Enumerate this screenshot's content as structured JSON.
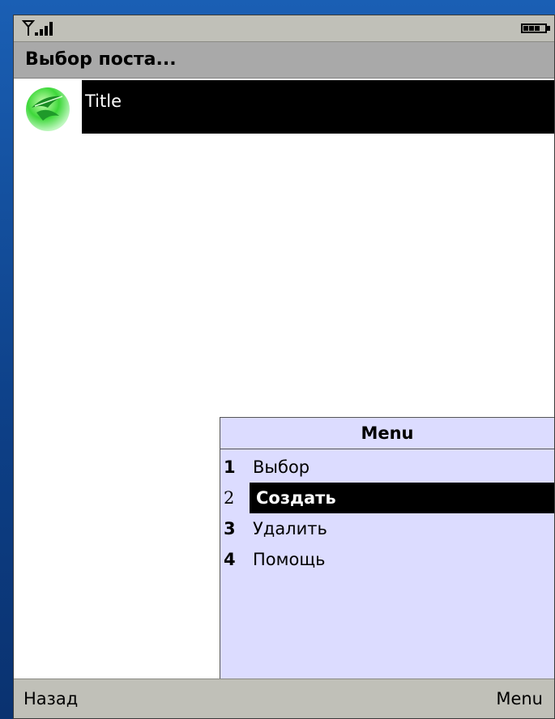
{
  "header": {
    "title": "Выбор поста..."
  },
  "list": {
    "items": [
      {
        "label": "Title",
        "icon": "green-leaf-icon",
        "selected": true
      }
    ]
  },
  "menu": {
    "title": "Menu",
    "items": [
      {
        "num": "1",
        "label": "Выбор"
      },
      {
        "num": "2",
        "label": "Создать",
        "selected": true
      },
      {
        "num": "3",
        "label": "Удалить"
      },
      {
        "num": "4",
        "label": "Помощь"
      }
    ]
  },
  "softkeys": {
    "left": "Назад",
    "right": "Menu"
  },
  "colors": {
    "selection": "#000000",
    "menu_bg": "#dcdcff",
    "bars": "#c0c0b8",
    "title_bar": "#a9a9a9",
    "desktop": "#1a5fb4"
  }
}
